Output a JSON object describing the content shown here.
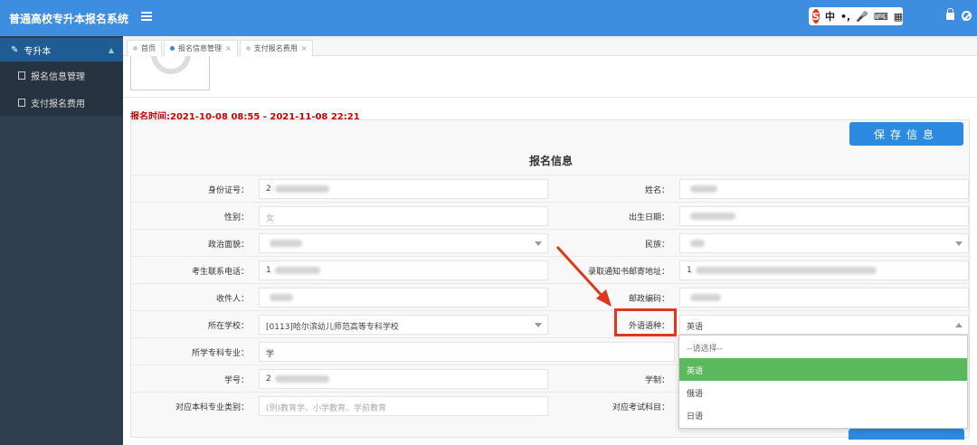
{
  "app": {
    "title": "普通高校专升本报名系统"
  },
  "ime": {
    "logo": "S",
    "mode": "中",
    "punct": "•,"
  },
  "sidebar": {
    "group_label": "专升本",
    "items": [
      {
        "label": "报名信息管理"
      },
      {
        "label": "支付报名费用"
      }
    ]
  },
  "tabs": [
    {
      "label": "首页",
      "active": false
    },
    {
      "label": "报名信息管理",
      "active": true
    },
    {
      "label": "支付报名费用",
      "active": false
    }
  ],
  "period": "报名时间:2021-10-08 08:55 - 2021-11-08 22:21",
  "form": {
    "save_label": "保存信息",
    "title": "报名信息",
    "rows": [
      {
        "l_label": "身份证号：",
        "l_value": "2",
        "r_label": "姓名：",
        "r_value": ""
      },
      {
        "l_label": "性别：",
        "l_value": "女",
        "r_label": "出生日期：",
        "r_value": ""
      },
      {
        "l_label": "政治面貌：",
        "l_value": "",
        "r_label": "民族：",
        "r_value": ""
      },
      {
        "l_label": "考生联系电话：",
        "l_value": "1",
        "r_label": "录取通知书邮寄地址：",
        "r_value": "1"
      },
      {
        "l_label": "收件人：",
        "l_value": "",
        "r_label": "邮政编码：",
        "r_value": ""
      },
      {
        "l_label": "所在学校：",
        "l_value": "[0113]哈尔滨幼儿师范高等专科学校",
        "r_label": "外语语种：",
        "r_value": "英语"
      },
      {
        "l_label": "所学专科专业：",
        "l_value": "学",
        "r_label": "",
        "r_value": ""
      },
      {
        "l_label": "学号：",
        "l_value": "2",
        "r_label": "学制：",
        "r_value": ""
      },
      {
        "l_label": "对应本科专业类别：",
        "l_value": "(例)教育学、小学教育、学前教育",
        "r_label": "对应考试科目：",
        "r_value": ""
      }
    ]
  },
  "language_dropdown": {
    "options": [
      "--请选择--",
      "英语",
      "俄语",
      "日语"
    ],
    "selected": "英语"
  },
  "colors": {
    "topbar": "#3d8ee0",
    "highlight": "#e0361f",
    "selected_option": "#5cb85c"
  }
}
